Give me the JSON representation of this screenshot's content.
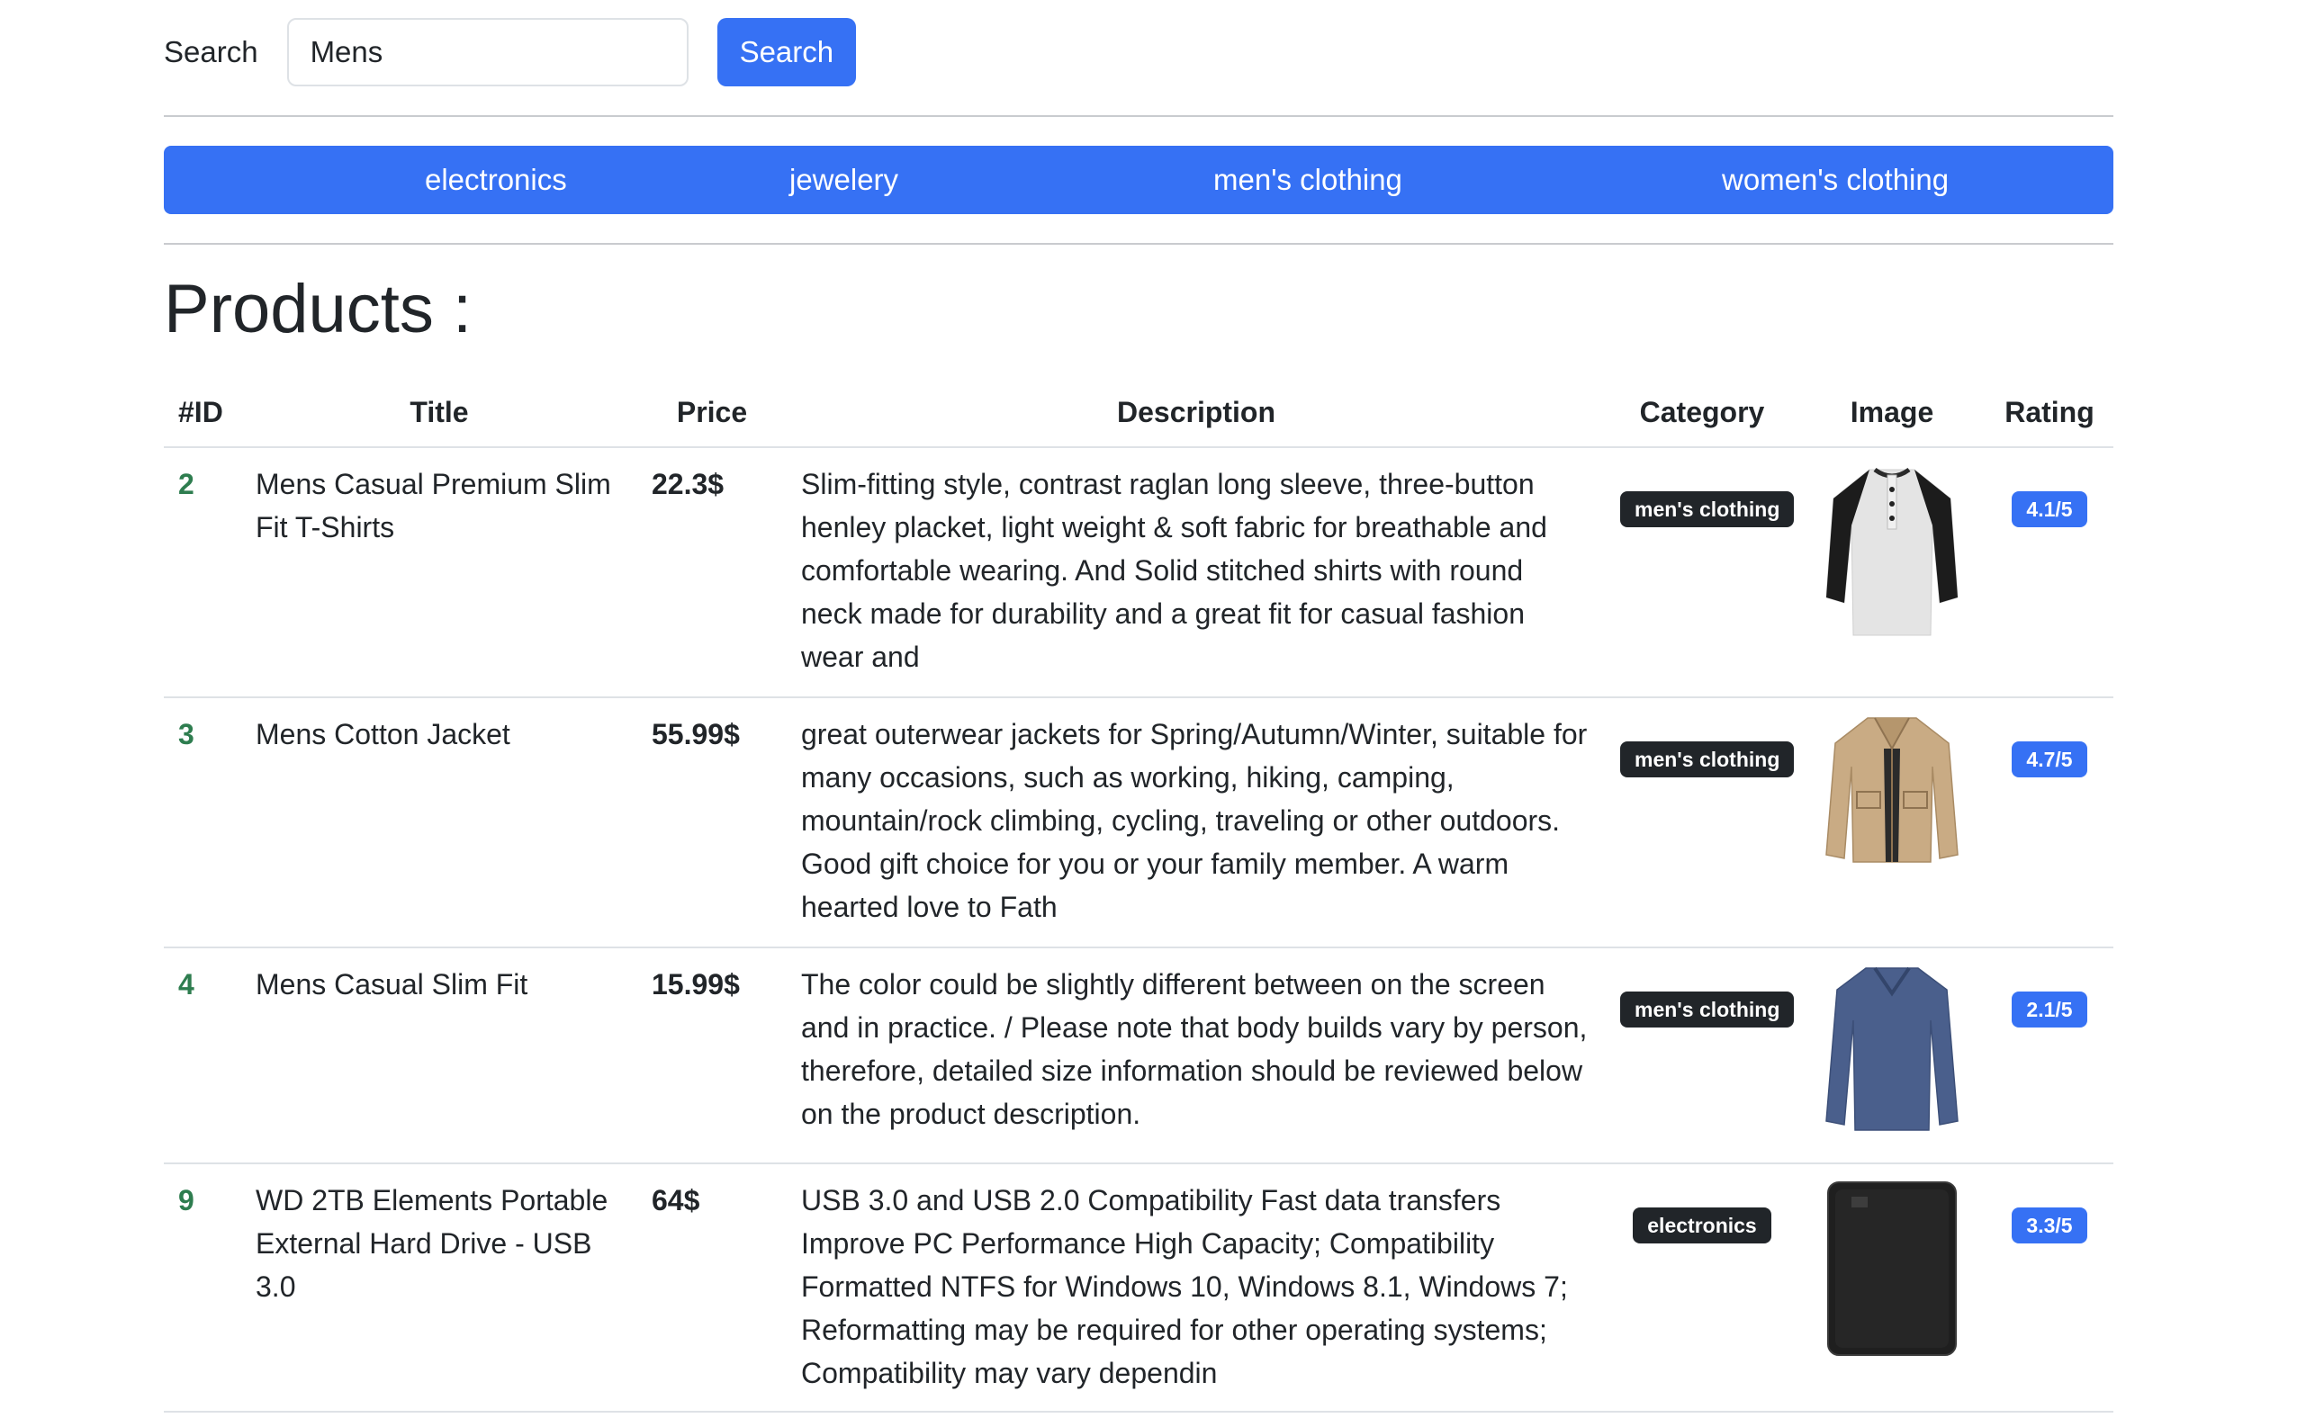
{
  "search": {
    "label": "Search",
    "value": "Mens",
    "button_label": "Search"
  },
  "categories": [
    "electronics",
    "jewelery",
    "men's clothing",
    "women's clothing"
  ],
  "products_heading": "Products :",
  "table": {
    "headers": [
      "#ID",
      "Title",
      "Price",
      "Description",
      "Category",
      "Image",
      "Rating"
    ],
    "rows": [
      {
        "id": "2",
        "title": "Mens Casual Premium Slim Fit T-Shirts",
        "price": "22.3$",
        "description": "Slim-fitting style, contrast raglan long sleeve, three-button henley placket, light weight & soft fabric for breathable and comfortable wearing. And Solid stitched shirts with round neck made for durability and a great fit for casual fashion wear and",
        "category": "men's clothing",
        "image_icon": "henley-shirt-image",
        "rating": "4.1/5"
      },
      {
        "id": "3",
        "title": "Mens Cotton Jacket",
        "price": "55.99$",
        "description": "great outerwear jackets for Spring/Autumn/Winter, suitable for many occasions, such as working, hiking, camping, mountain/rock climbing, cycling, traveling or other outdoors. Good gift choice for you or your family member. A warm hearted love to Fath",
        "category": "men's clothing",
        "image_icon": "cotton-jacket-image",
        "rating": "4.7/5"
      },
      {
        "id": "4",
        "title": "Mens Casual Slim Fit",
        "price": "15.99$",
        "description": "The color could be slightly different between on the screen and in practice. / Please note that body builds vary by person, therefore, detailed size information should be reviewed below on the product description.",
        "category": "men's clothing",
        "image_icon": "long-sleeve-shirt-image",
        "rating": "2.1/5"
      },
      {
        "id": "9",
        "title": "WD 2TB Elements Portable External Hard Drive - USB 3.0",
        "price": "64$",
        "description": "USB 3.0 and USB 2.0 Compatibility Fast data transfers Improve PC Performance High Capacity; Compatibility Formatted NTFS for Windows 10, Windows 8.1, Windows 7; Reformatting may be required for other operating systems; Compatibility may vary dependin",
        "category": "electronics",
        "image_icon": "hard-drive-image",
        "rating": "3.3/5"
      }
    ]
  },
  "colors": {
    "primary": "#3671f4",
    "badge_dark": "#212529",
    "id_green": "#2e7d4f",
    "divider": "#dee2e6"
  }
}
